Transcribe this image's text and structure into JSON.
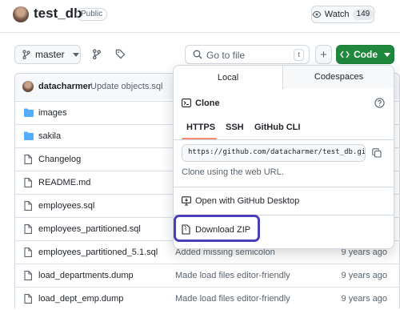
{
  "repo": {
    "name": "test_db",
    "visibility": "Public"
  },
  "watch": {
    "label": "Watch",
    "count": "149"
  },
  "toolbar": {
    "branch": "master",
    "search_placeholder": "Go to file",
    "search_key": "t",
    "add": "+",
    "code": "Code"
  },
  "commit": {
    "author": "datacharmer",
    "message": "Update objects.sql"
  },
  "files": [
    {
      "name": "images",
      "type": "folder",
      "commit": "",
      "time": ""
    },
    {
      "name": "sakila",
      "type": "folder",
      "commit": "",
      "time": ""
    },
    {
      "name": "Changelog",
      "type": "file",
      "commit": "",
      "time": ""
    },
    {
      "name": "README.md",
      "type": "file",
      "commit": "",
      "time": ""
    },
    {
      "name": "employees.sql",
      "type": "file",
      "commit": "",
      "time": ""
    },
    {
      "name": "employees_partitioned.sql",
      "type": "file",
      "commit": "",
      "time": ""
    },
    {
      "name": "employees_partitioned_5.1.sql",
      "type": "file",
      "commit": "Added missing semicolon",
      "time": "9 years ago"
    },
    {
      "name": "load_departments.dump",
      "type": "file",
      "commit": "Made load files editor-friendly",
      "time": "9 years ago"
    },
    {
      "name": "load_dept_emp.dump",
      "type": "file",
      "commit": "Made load files editor-friendly",
      "time": "9 years ago"
    }
  ],
  "dropdown": {
    "tabs": [
      "Local",
      "Codespaces"
    ],
    "clone_title": "Clone",
    "protocols": [
      "HTTPS",
      "SSH",
      "GitHub CLI"
    ],
    "clone_url": "https://github.com/datacharmer/test_db.git",
    "clone_hint": "Clone using the web URL.",
    "desktop": "Open with GitHub Desktop",
    "zip": "Download ZIP"
  },
  "colors": {
    "code_green": "#1f883d",
    "highlight": "#4b3fb8",
    "folder": "#54aeff",
    "link_accent": "#fd8c73"
  }
}
